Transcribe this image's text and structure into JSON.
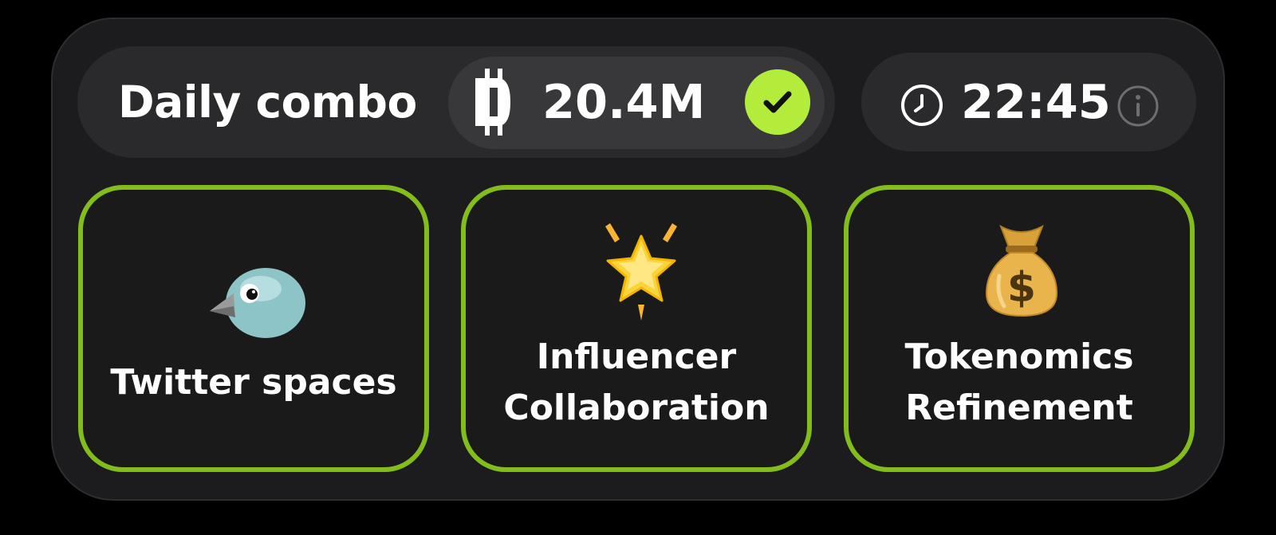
{
  "header": {
    "title": "Daily combo",
    "reward": {
      "value": "20.4M",
      "icon": "coin-icon",
      "claimed": true,
      "check_color": "#b3ec3a"
    },
    "timer": {
      "value": "22:45",
      "icon": "clock-icon",
      "info_icon": "info-icon"
    }
  },
  "cards": [
    {
      "label_lines": [
        "Twitter spaces"
      ],
      "icon": "bird-icon"
    },
    {
      "label_lines": [
        "Influencer",
        "Collaboration"
      ],
      "icon": "glowing-star-icon"
    },
    {
      "label_lines": [
        "Tokenomics",
        "Refinement"
      ],
      "icon": "money-bag-icon"
    }
  ],
  "colors": {
    "accent_border": "#82bd1c",
    "panel_bg": "#1c1c1e",
    "pill_bg": "#2a2a2c"
  }
}
